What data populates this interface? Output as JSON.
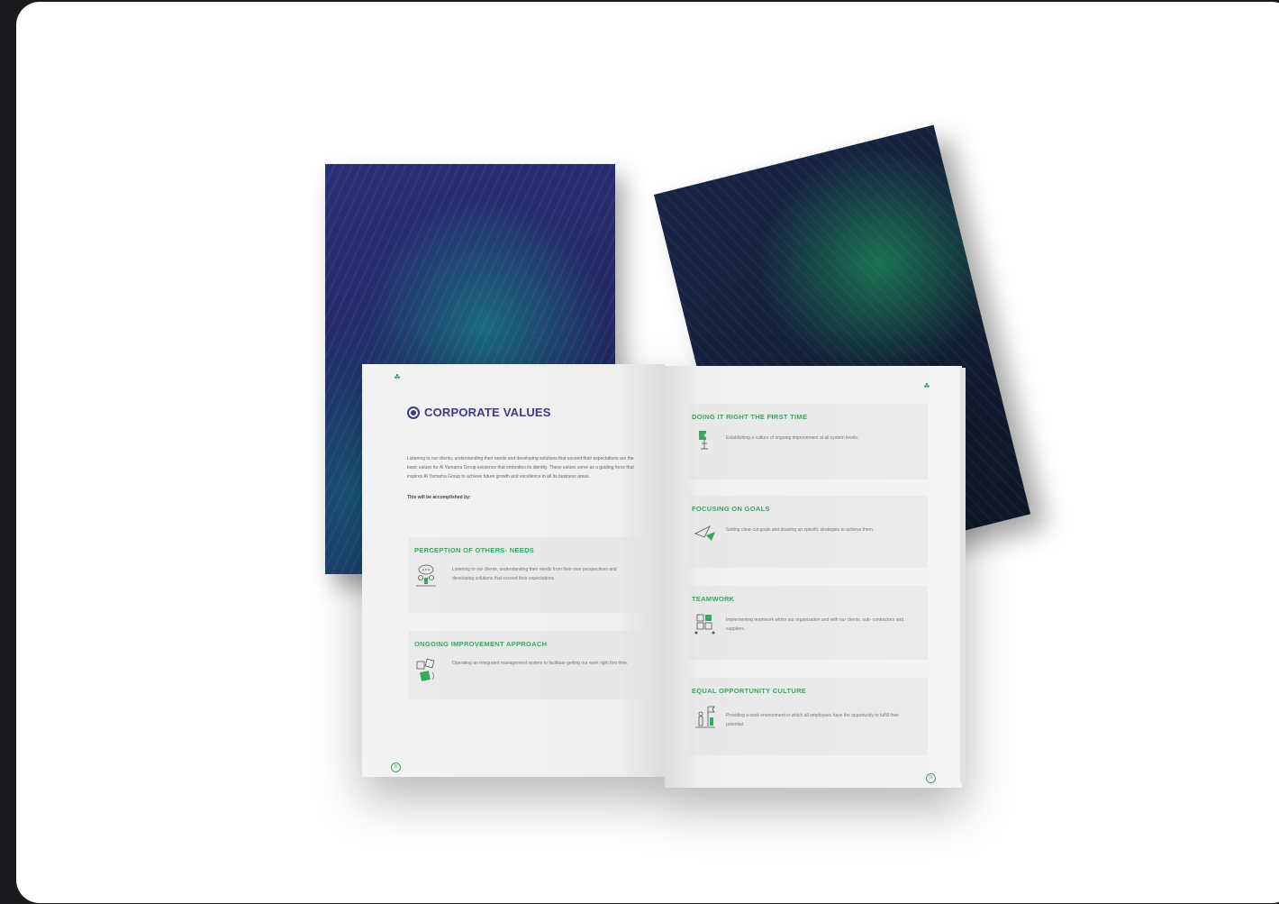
{
  "left_page": {
    "title": "CORPORATE VALUES",
    "intro": "Listening to our clients, understanding their needs and developing solutions that exceed their expectations are the basic values for Al Yamama Group existence that embodies its identity. These values serve as a guiding force that inspires Al Yamama Group to achieve future growth and excellence in all its business areas.",
    "intro_strong": "This will be accomplished by:",
    "sections": [
      {
        "title": "PERCEPTION OF OTHERS- NEEDS",
        "text": "Listening to our clients, understanding their needs from their own perspectives and developing solutions that exceed their expectations.",
        "icon": "meeting-icon"
      },
      {
        "title": "ONGOING IMPROVEMENT APPROACH",
        "text": "Operating an integrated management system to facilitate getting our work right first time.",
        "icon": "puzzle-icon"
      }
    ],
    "page_number": "8"
  },
  "right_page": {
    "sections": [
      {
        "title": "DOING IT RIGHT THE FIRST TIME",
        "text": "Establishing a culture of ongoing improvement at all system levels.",
        "icon": "puzzle-hand-icon"
      },
      {
        "title": "FOCUSING ON GOALS",
        "text": "Setting clear-cut goals and drawing up specific strategies to achieve them.",
        "icon": "paper-plane-icon"
      },
      {
        "title": "TEAMWORK",
        "text": "Implementing teamwork within our organization and with our clients, sub- contractors and suppliers.",
        "icon": "teamwork-icon"
      },
      {
        "title": "EQUAL OPPORTUNITY CULTURE",
        "text": "Providing a work environment in which all employees have the opportunity to fulfill their potential.",
        "icon": "flag-people-icon"
      }
    ],
    "page_number": "9"
  },
  "colors": {
    "title": "#3e3a8c",
    "section_title": "#36a85f",
    "cover_left": "#2c2f78",
    "cover_right": "#15203a"
  }
}
